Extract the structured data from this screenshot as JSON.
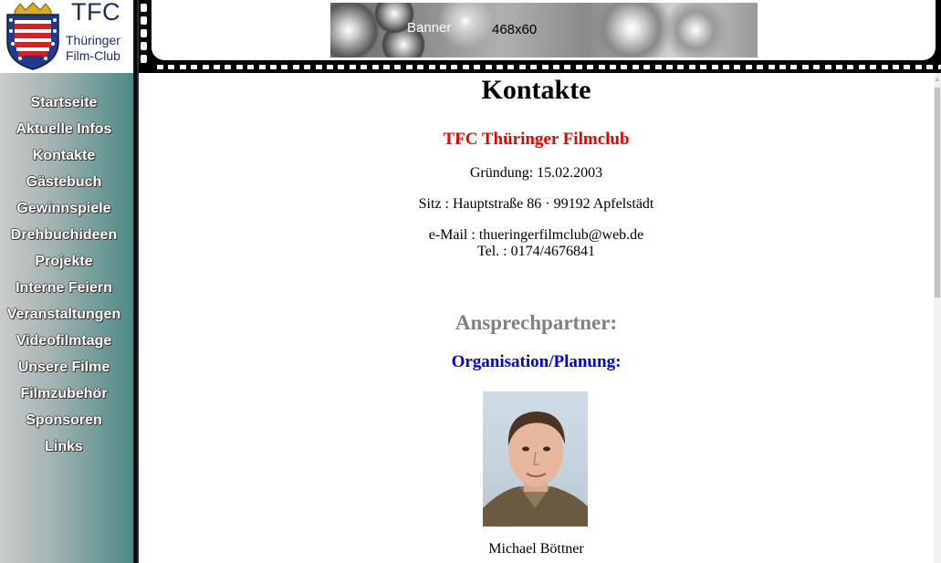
{
  "logo": {
    "title": "TFC",
    "subtitle_line1": "Thüringer",
    "subtitle_line2": "Film-Club",
    "icon": "thuringia-crest-icon"
  },
  "nav": {
    "items": [
      {
        "label": "Startseite"
      },
      {
        "label": "Aktuelle Infos"
      },
      {
        "label": "Kontakte"
      },
      {
        "label": "Gästebuch"
      },
      {
        "label": "Gewinnspiele"
      },
      {
        "label": "Drehbuchideen"
      },
      {
        "label": "Projekte"
      },
      {
        "label": "Interne Feiern"
      },
      {
        "label": "Veranstaltungen"
      },
      {
        "label": "Videofilmtage"
      },
      {
        "label": "Unsere Filme"
      },
      {
        "label": "Filmzubehör"
      },
      {
        "label": "Sponsoren"
      },
      {
        "label": "Links"
      }
    ]
  },
  "banner": {
    "word": "Banner",
    "size": "468x60"
  },
  "content": {
    "title": "Kontakte",
    "club_name": "TFC Thüringer Filmclub",
    "founding": "Gründung: 15.02.2003",
    "address": "Sitz : Hauptstraße 86 · 99192 Apfelstädt",
    "email": "e-Mail : thueringerfilmclub@web.de",
    "phone": "Tel. : 0174/4676841",
    "contacts_heading": "Ansprechpartner:",
    "org_heading": "Organisation/Planung:",
    "person_name": "Michael Böttner"
  },
  "colors": {
    "club_name": "#ee0000",
    "contacts_heading": "#808080",
    "org_heading": "#0000ee",
    "sidebar_accent": "#4f8a86"
  }
}
